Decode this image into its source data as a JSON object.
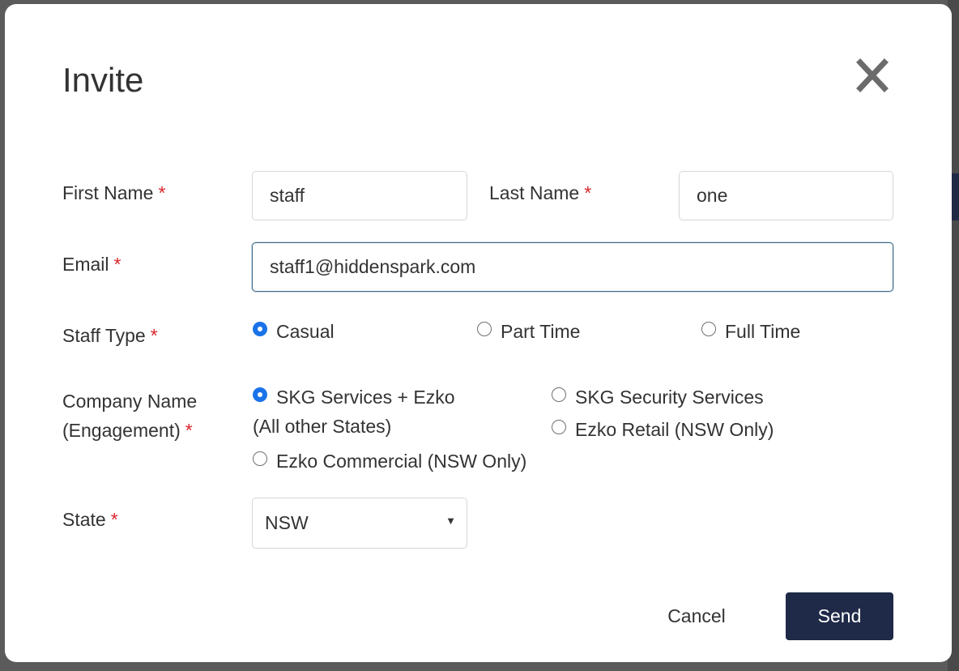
{
  "dialog": {
    "title": "Invite",
    "close_icon": "close-icon"
  },
  "form": {
    "first_name": {
      "label": "First Name",
      "required": "*",
      "value": "staff"
    },
    "last_name": {
      "label": "Last Name",
      "required": "*",
      "value": "one"
    },
    "email": {
      "label": "Email",
      "required": "*",
      "value": "staff1@hiddenspark.com"
    },
    "staff_type": {
      "label": "Staff Type",
      "required": "*",
      "options": [
        {
          "label": "Casual",
          "selected": true
        },
        {
          "label": "Part Time",
          "selected": false
        },
        {
          "label": "Full Time",
          "selected": false
        }
      ]
    },
    "company": {
      "label_line1": "Company Name",
      "label_line2": "(Engagement)",
      "required": "*",
      "options": [
        {
          "label": "SKG Services + Ezko",
          "sublabel": "(All other States)",
          "selected": true
        },
        {
          "label": "SKG Security Services",
          "selected": false
        },
        {
          "label": "Ezko Retail (NSW Only)",
          "selected": false
        },
        {
          "label": "Ezko Commercial (NSW Only)",
          "selected": false
        }
      ]
    },
    "state": {
      "label": "State",
      "required": "*",
      "value": "NSW"
    }
  },
  "actions": {
    "cancel": "Cancel",
    "send": "Send"
  },
  "colors": {
    "primary": "#1f2a48",
    "radio_selected": "#1a73e8",
    "required": "#d9262c"
  }
}
